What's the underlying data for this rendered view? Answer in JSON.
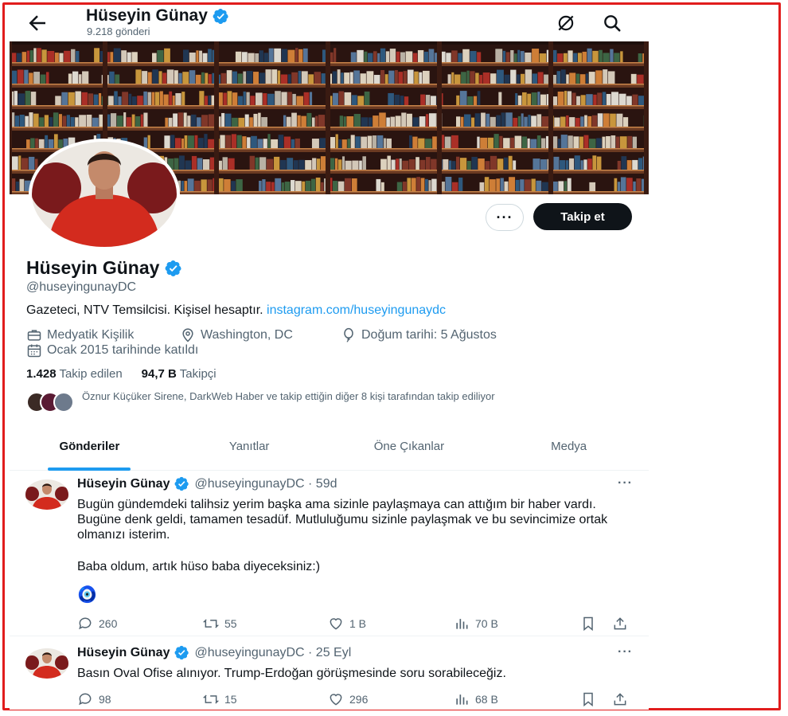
{
  "header": {
    "name": "Hüseyin Günay",
    "post_count": "9.218 gönderi"
  },
  "profile": {
    "name": "Hüseyin Günay",
    "handle": "@huseyingunayDC",
    "bio_text": "Gazeteci, NTV Temsilcisi. Kişisel hesaptır.",
    "bio_link": "instagram.com/huseyingunaydc",
    "category": "Medyatik Kişilik",
    "location": "Washington, DC",
    "birthday": "Doğum tarihi: 5 Ağustos",
    "joined": "Ocak 2015 tarihinde katıldı",
    "following_count": "1.428",
    "following_label": "Takip edilen",
    "followers_count": "94,7 B",
    "followers_label": "Takipçi",
    "followed_by": "Öznur Küçüker Sirene, DarkWeb Haber ve takip ettiğin diğer 8 kişi tarafından takip ediliyor",
    "follow_label": "Takip et",
    "more_label": "···"
  },
  "tabs": [
    "Gönderiler",
    "Yanıtlar",
    "Öne Çıkanlar",
    "Medya"
  ],
  "tweets": [
    {
      "name": "Hüseyin Günay",
      "handle_time": "@huseyingunayDC · 59d",
      "line1": "Bugün gündemdeki talihsiz yerim başka ama sizinle paylaşmaya can attığım bir haber vardı. Bugüne denk geldi, tamamen tesadüf. Mutluluğumu sizinle paylaşmak ve bu sevincimize ortak olmanızı isterim.",
      "line2": "Baba oldum, artık hüso baba diyeceksiniz:)",
      "emoji": "🧿",
      "replies": "260",
      "retweets": "55",
      "likes": "1 B",
      "views": "70 B"
    },
    {
      "name": "Hüseyin Günay",
      "handle_time": "@huseyingunayDC · 25 Eyl",
      "line1": "Basın Oval Ofise alınıyor. Trump-Erdoğan görüşmesinde soru sorabileceğiz.",
      "replies": "98",
      "retweets": "15",
      "likes": "296",
      "views": "68 B"
    }
  ],
  "colors": {
    "accent": "#1d9bf0",
    "frame": "#e11d1d",
    "text": "#0f1419",
    "muted": "#536471"
  }
}
